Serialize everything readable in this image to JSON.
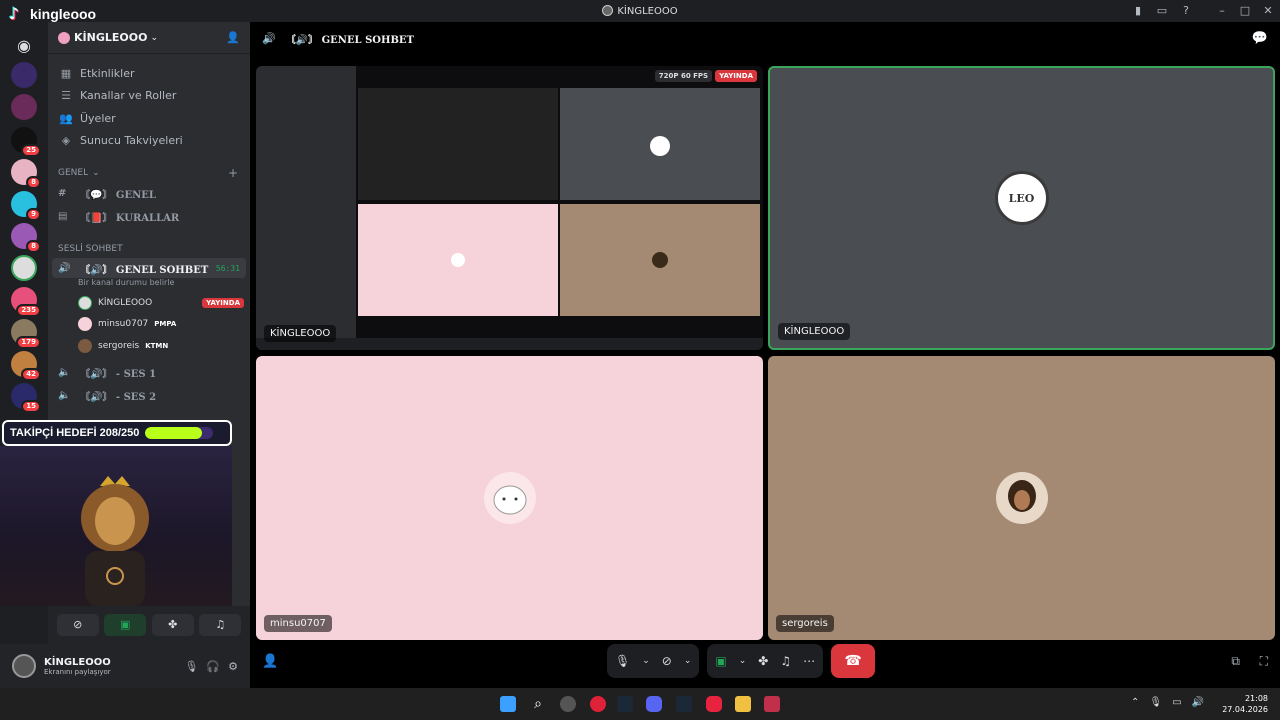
{
  "window": {
    "title": "KİNGLEOOO"
  },
  "overlay": {
    "tiktok_name": "kingleooo",
    "goal_label": "TAKİPÇİ HEDEFİ 208/250",
    "goal_progress": 0.832
  },
  "server": {
    "name": "KİNGLEOOO"
  },
  "nav": [
    "Etkinlikler",
    "Kanallar ve Roller",
    "Üyeler",
    "Sunucu Takviyeleri"
  ],
  "categories": {
    "general": "GENEL",
    "voice": "SESLİ SOHBET"
  },
  "text_channels": [
    "〘💬〙 GENEL",
    "〘📕〙 KURALLAR"
  ],
  "voice": {
    "active_channel": "〘🔊〙 GENEL SOHBET",
    "timer": "56:31",
    "status": "Bir kanal durumu belirle",
    "users": [
      {
        "name": "KİNGLEOOO",
        "tag": "YAYINDA"
      },
      {
        "name": "minsu0707",
        "tag": "PMPA"
      },
      {
        "name": "sergoreis",
        "tag": "KTMN"
      }
    ],
    "other_channels": [
      "〘🔊〙 - SES 1",
      "〘🔊〙 - SES 2"
    ]
  },
  "rail_badges": [
    "25",
    "8",
    "9",
    "8",
    "235",
    "179",
    "42",
    "15"
  ],
  "user": {
    "name": "KİNGLEOOO",
    "status": "Ekranını paylaşıyor"
  },
  "main": {
    "channel": "〘🔊〙 GENEL SOHBET"
  },
  "tiles": [
    {
      "label": "KİNGLEOOO",
      "quality": "720P 60 FPS",
      "live": "YAYINDA"
    },
    {
      "label": "KİNGLEOOO"
    },
    {
      "label": "minsu0707"
    },
    {
      "label": "sergoreis"
    }
  ],
  "clock": {
    "time": "21:08",
    "date": "27.04.2026"
  },
  "colors": {
    "live": "#da373c",
    "speaking": "#3ba55c",
    "goal_fill": "#b8ff1a"
  }
}
